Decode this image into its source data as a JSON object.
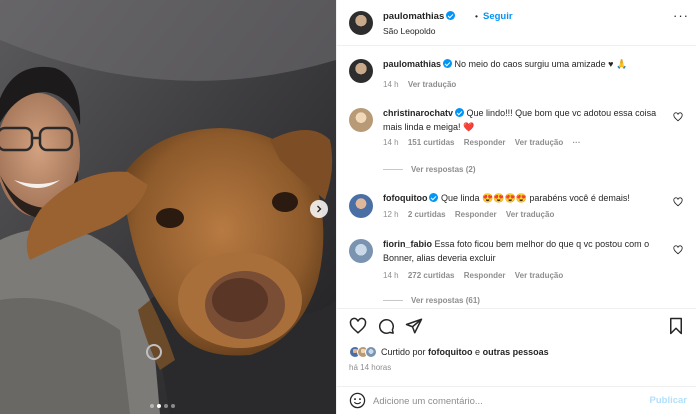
{
  "post": {
    "author": "paulomathias",
    "follow_label": "Seguir",
    "location": "São Leopoldo",
    "caption": "No meio do caos surgiu uma amizade ♥",
    "caption_emoji": "🙏",
    "caption_time": "14 h",
    "see_translation": "Ver tradução"
  },
  "comments": [
    {
      "user": "christinarochatv",
      "verified": true,
      "text": "Que lindo!!! Que bom que vc adotou essa coisa mais linda e meiga! ❤️",
      "time": "14 h",
      "likes": "151 curtidas",
      "reply": "Responder",
      "translate": "Ver tradução",
      "view_replies": "Ver respostas (2)"
    },
    {
      "user": "fofoquitoo",
      "verified": true,
      "text": "Que linda 😍😍😍😍 parabéns você é demais!",
      "time": "12 h",
      "likes": "2 curtidas",
      "reply": "Responder",
      "translate": "Ver tradução"
    },
    {
      "user": "fiorin_fabio",
      "verified": false,
      "text": "Essa foto ficou bem melhor do que q vc postou com o Bonner, alias deveria excluir",
      "time": "14 h",
      "likes": "272 curtidas",
      "reply": "Responder",
      "translate": "Ver tradução",
      "view_replies": "Ver respostas (61)"
    }
  ],
  "likes": {
    "prefix": "Curtido por",
    "user": "fofoquitoo",
    "connector": "e",
    "others": "outras pessoas"
  },
  "timestamp": "há 14 horas",
  "comment_box": {
    "placeholder": "Adicione um comentário...",
    "publish_label": "Publicar"
  },
  "carousel": {
    "slide_count": 4,
    "active_index": 1
  },
  "colors": {
    "accent": "#0095f6",
    "text": "#262626",
    "muted": "#8e8e8e",
    "like_heart": "#ed4956"
  },
  "icons": [
    "heart-icon",
    "comment-icon",
    "share-icon",
    "bookmark-icon",
    "more-icon",
    "emoji-icon",
    "chevron-right-icon",
    "verified-badge-icon"
  ]
}
